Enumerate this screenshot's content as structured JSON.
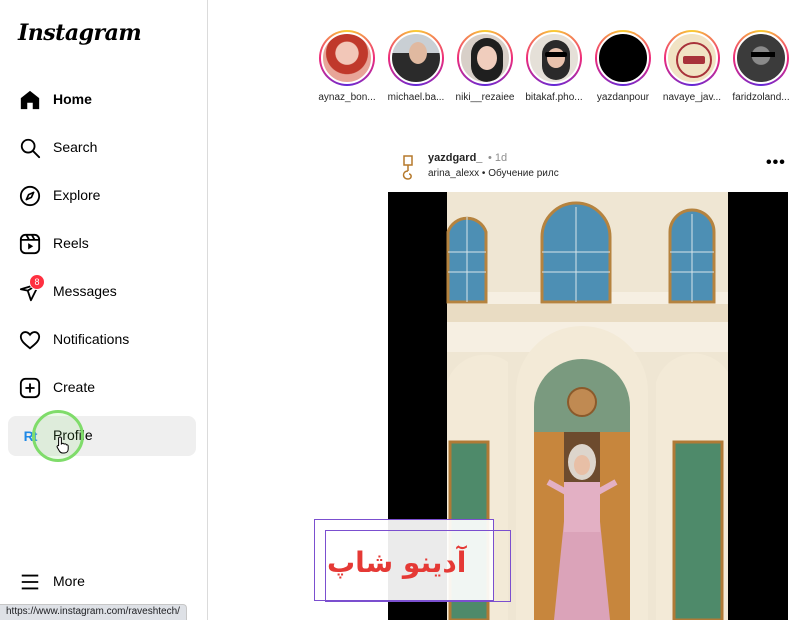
{
  "app": {
    "logo_text": "Instagram"
  },
  "sidebar": {
    "items": [
      {
        "key": "home",
        "label": "Home",
        "active": true
      },
      {
        "key": "search",
        "label": "Search"
      },
      {
        "key": "explore",
        "label": "Explore"
      },
      {
        "key": "reels",
        "label": "Reels"
      },
      {
        "key": "messages",
        "label": "Messages",
        "badge": "8"
      },
      {
        "key": "notifications",
        "label": "Notifications"
      },
      {
        "key": "create",
        "label": "Create"
      },
      {
        "key": "profile",
        "label": "Profile",
        "avatar_text": "Rt"
      }
    ],
    "more_label": "More"
  },
  "status_url": "https://www.instagram.com/raveshtech/",
  "stories": [
    {
      "name": "aynaz_bon...",
      "avatar_color": "#e8a598"
    },
    {
      "name": "michael.ba...",
      "avatar_color": "#9aa3ab"
    },
    {
      "name": "niki__rezaiee",
      "avatar_color": "#c9b7b0"
    },
    {
      "name": "bitakaf.pho...",
      "avatar_color": "#d9d2c6"
    },
    {
      "name": "yazdanpour",
      "avatar_color": "#000000"
    },
    {
      "name": "navaye_jav...",
      "avatar_color": "#f1e3c4"
    },
    {
      "name": "faridzoland...",
      "avatar_color": "#3b3b3b"
    }
  ],
  "post": {
    "username": "yazdgard_",
    "time": "• 1d",
    "subtitle": "arina_alexx • Обучение рилс",
    "more_icon": "•••"
  },
  "watermark": {
    "text": "آدینو شاپ"
  }
}
